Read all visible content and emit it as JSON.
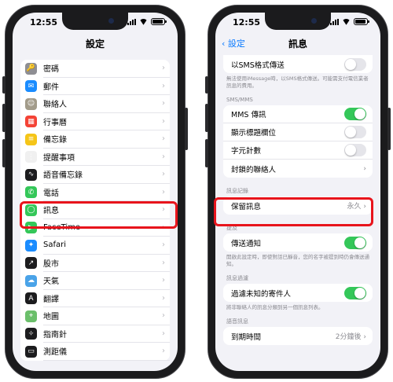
{
  "status": {
    "time": "12:55"
  },
  "left": {
    "title": "設定",
    "items": [
      {
        "label": "密碼",
        "icon": "lock-icon",
        "color": "#8e8e93"
      },
      {
        "label": "郵件",
        "icon": "mail-icon",
        "color": "#1a8cff"
      },
      {
        "label": "聯絡人",
        "icon": "contacts-icon",
        "color": "#a29b8a"
      },
      {
        "label": "行事曆",
        "icon": "calendar-icon",
        "color": "#f44336"
      },
      {
        "label": "備忘錄",
        "icon": "notes-icon",
        "color": "#f5c518"
      },
      {
        "label": "提醒事項",
        "icon": "reminders-icon",
        "color": "#f0f0f0"
      },
      {
        "label": "語音備忘錄",
        "icon": "voice-memos-icon",
        "color": "#1c1c1e"
      },
      {
        "label": "電話",
        "icon": "phone-icon",
        "color": "#34c759"
      },
      {
        "label": "訊息",
        "icon": "messages-icon",
        "color": "#34c759"
      },
      {
        "label": "FaceTime",
        "icon": "facetime-icon",
        "color": "#34c759"
      },
      {
        "label": "Safari",
        "icon": "safari-icon",
        "color": "#1a8cff"
      },
      {
        "label": "股市",
        "icon": "stocks-icon",
        "color": "#1c1c1e"
      },
      {
        "label": "天氣",
        "icon": "weather-icon",
        "color": "#4aa3e8"
      },
      {
        "label": "翻譯",
        "icon": "translate-icon",
        "color": "#1c1c1e"
      },
      {
        "label": "地圖",
        "icon": "maps-icon",
        "color": "#6bbf6b"
      },
      {
        "label": "指南針",
        "icon": "compass-icon",
        "color": "#1c1c1e"
      },
      {
        "label": "測距儀",
        "icon": "measure-icon",
        "color": "#1c1c1e"
      }
    ]
  },
  "right": {
    "back_label": "設定",
    "title": "訊息",
    "sms_label": "以SMS格式傳送",
    "sms_note": "無法使用iMessage時，以SMS格式傳送。可能需支付電信業者訊息的費用。",
    "mms_header": "SMS/MMS",
    "mms_rows": [
      {
        "label": "MMS 傳訊",
        "on": true
      },
      {
        "label": "顯示標題欄位",
        "on": false
      },
      {
        "label": "字元計數",
        "on": false
      },
      {
        "label": "封鎖的聯絡人",
        "chevron": true
      }
    ],
    "history_header": "訊息記錄",
    "keep_label": "保留訊息",
    "keep_value": "永久",
    "mentions_header": "提及",
    "notify_label": "傳送通知",
    "notify_on": true,
    "notify_note": "開啟此設定時，即使對話已靜音，您的名字被提到時仍會傳送通知。",
    "filter_header": "訊息過濾",
    "filter_label": "過濾未知的寄件人",
    "filter_on": true,
    "filter_note": "將非聯絡人的訊息分類到另一個訊息列表。",
    "audio_header": "語音訊息",
    "expire_label": "到期時間",
    "expire_value": "2分鐘後"
  },
  "highlight_color": "#e8141c"
}
